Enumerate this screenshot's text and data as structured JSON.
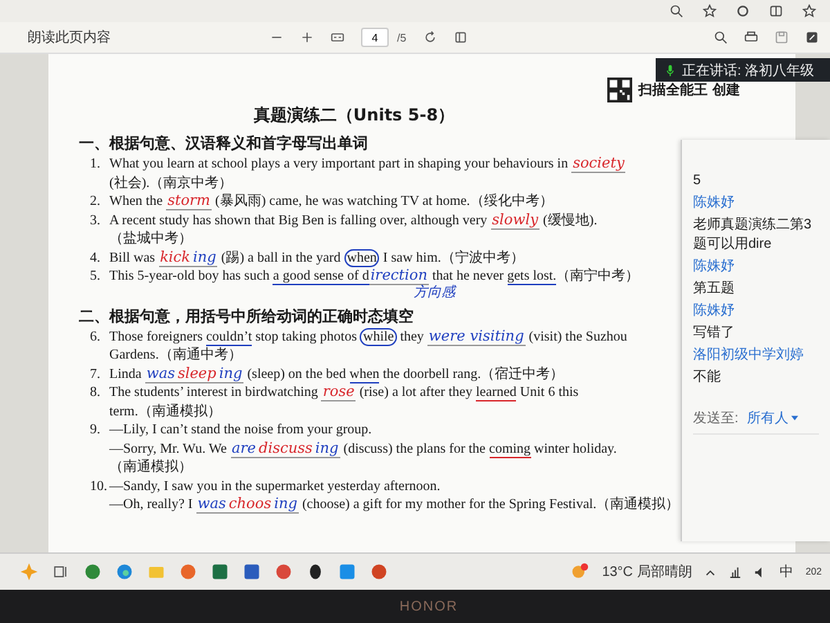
{
  "toolbar": {
    "read_aloud": "朗读此页内容",
    "page_input": "4",
    "page_total": "/5"
  },
  "speaking_banner": "正在讲话: 洛初八年级",
  "document": {
    "scan_header": "扫描全能王 创建",
    "title": "真题演练二（Units 5-8）",
    "sections": [
      {
        "heading": "一、根据句意、汉语释义和首字母写出单词",
        "questions": [
          {
            "number": "1.",
            "lines": [
              {
                "segments": [
                  {
                    "kind": "text",
                    "text": "What you learn at school plays a very important part in shaping your behaviours in "
                  },
                  {
                    "kind": "answer",
                    "text": "society",
                    "color": "#d8262b"
                  }
                ]
              },
              {
                "segments": [
                  {
                    "kind": "text",
                    "text": "(社会).（南京中考）"
                  }
                ]
              }
            ]
          },
          {
            "number": "2.",
            "lines": [
              {
                "segments": [
                  {
                    "kind": "text",
                    "text": "When the "
                  },
                  {
                    "kind": "answer",
                    "text": "storm",
                    "color": "#d8262b"
                  },
                  {
                    "kind": "text",
                    "text": " (暴风雨) came, he was watching TV at home.（绥化中考）"
                  }
                ]
              }
            ]
          },
          {
            "number": "3.",
            "lines": [
              {
                "segments": [
                  {
                    "kind": "text",
                    "text": "A recent study has shown that Big Ben is falling over, although very "
                  },
                  {
                    "kind": "answer",
                    "text": "slowly",
                    "color": "#d8262b"
                  },
                  {
                    "kind": "text",
                    "text": " (缓慢地)."
                  }
                ]
              },
              {
                "segments": [
                  {
                    "kind": "text",
                    "text": "（盐城中考）"
                  }
                ]
              }
            ]
          },
          {
            "number": "4.",
            "lines": [
              {
                "segments": [
                  {
                    "kind": "text",
                    "text": "Bill was "
                  },
                  {
                    "kind": "answer",
                    "text": "kick",
                    "color": "#d8262b"
                  },
                  {
                    "kind": "answer",
                    "text": "ing",
                    "color": "#1f3fbf"
                  },
                  {
                    "kind": "text",
                    "text": " (踢) a ball in the yard "
                  },
                  {
                    "kind": "circled",
                    "text": "when",
                    "color": "#1f3fbf"
                  },
                  {
                    "kind": "text",
                    "text": " I saw him.（宁波中考）"
                  }
                ]
              }
            ]
          },
          {
            "number": "5.",
            "lines": [
              {
                "segments": [
                  {
                    "kind": "text",
                    "text": "This 5-year-old boy has such "
                  },
                  {
                    "kind": "underlined",
                    "text": "a good sense of d",
                    "color": "#1f3fbf"
                  },
                  {
                    "kind": "answer",
                    "text": "irection",
                    "color": "#1f3fbf"
                  },
                  {
                    "kind": "text",
                    "text": " that he never "
                  },
                  {
                    "kind": "underlined",
                    "text": "gets lost.",
                    "color": "#1f3fbf"
                  },
                  {
                    "kind": "text",
                    "text": "（南宁中考）"
                  }
                ]
              }
            ],
            "note": "方向感"
          }
        ]
      },
      {
        "heading": "二、根据句意，用括号中所给动词的正确时态填空",
        "questions": [
          {
            "number": "6.",
            "lines": [
              {
                "segments": [
                  {
                    "kind": "text",
                    "text": "Those foreigners "
                  },
                  {
                    "kind": "underlined",
                    "text": "couldn’t",
                    "color": "#1f3fbf"
                  },
                  {
                    "kind": "text",
                    "text": " stop taking photos "
                  },
                  {
                    "kind": "circled",
                    "text": "while",
                    "color": "#1f3fbf"
                  },
                  {
                    "kind": "text",
                    "text": " they "
                  },
                  {
                    "kind": "answer",
                    "text": "were visiting",
                    "color": "#1f3fbf"
                  },
                  {
                    "kind": "text",
                    "text": " (visit) the Suzhou"
                  }
                ]
              },
              {
                "segments": [
                  {
                    "kind": "text",
                    "text": "Gardens.（南通中考）"
                  }
                ]
              }
            ]
          },
          {
            "number": "7.",
            "lines": [
              {
                "segments": [
                  {
                    "kind": "text",
                    "text": "Linda "
                  },
                  {
                    "kind": "answer",
                    "text": "was",
                    "color": "#1f3fbf"
                  },
                  {
                    "kind": "answer",
                    "text": "sleep",
                    "color": "#d8262b"
                  },
                  {
                    "kind": "answer",
                    "text": "ing",
                    "color": "#1f3fbf"
                  },
                  {
                    "kind": "text",
                    "text": " (sleep) on the bed "
                  },
                  {
                    "kind": "underlined",
                    "text": "when",
                    "color": "#1f3fbf"
                  },
                  {
                    "kind": "text",
                    "text": " the doorbell rang.（宿迁中考）"
                  }
                ]
              }
            ]
          },
          {
            "number": "8.",
            "lines": [
              {
                "segments": [
                  {
                    "kind": "text",
                    "text": "The students’ interest in birdwatching "
                  },
                  {
                    "kind": "answer",
                    "text": "rose",
                    "color": "#d8262b"
                  },
                  {
                    "kind": "text",
                    "text": " (rise) a lot after they "
                  },
                  {
                    "kind": "underlined",
                    "text": "learned",
                    "color": "#d8262b"
                  },
                  {
                    "kind": "text",
                    "text": " Unit 6 this"
                  }
                ]
              },
              {
                "segments": [
                  {
                    "kind": "text",
                    "text": "term.（南通模拟）"
                  }
                ]
              }
            ]
          },
          {
            "number": "9.",
            "lines": [
              {
                "segments": [
                  {
                    "kind": "text",
                    "text": "—Lily, I can’t stand the noise from your group."
                  }
                ]
              },
              {
                "segments": [
                  {
                    "kind": "text",
                    "text": "—Sorry, Mr. Wu. We "
                  },
                  {
                    "kind": "answer",
                    "text": "are",
                    "color": "#1f3fbf"
                  },
                  {
                    "kind": "answer",
                    "text": "discuss",
                    "color": "#d8262b"
                  },
                  {
                    "kind": "answer",
                    "text": "ing",
                    "color": "#1f3fbf"
                  },
                  {
                    "kind": "text",
                    "text": " (discuss) the plans for the "
                  },
                  {
                    "kind": "underlined",
                    "text": "coming",
                    "color": "#d8262b"
                  },
                  {
                    "kind": "text",
                    "text": " winter holiday."
                  }
                ]
              },
              {
                "segments": [
                  {
                    "kind": "text",
                    "text": "（南通模拟）"
                  }
                ]
              }
            ]
          },
          {
            "number": "10.",
            "lines": [
              {
                "segments": [
                  {
                    "kind": "text",
                    "text": "—Sandy, I saw you in the supermarket yesterday afternoon."
                  }
                ]
              },
              {
                "segments": [
                  {
                    "kind": "text",
                    "text": "—Oh, really? I "
                  },
                  {
                    "kind": "answer",
                    "text": "was",
                    "color": "#1f3fbf"
                  },
                  {
                    "kind": "answer",
                    "text": "choos",
                    "color": "#d8262b"
                  },
                  {
                    "kind": "answer",
                    "text": "ing",
                    "color": "#1f3fbf"
                  },
                  {
                    "kind": "text",
                    "text": " (choose) a gift for my mother for the Spring Festival.（南通模拟）"
                  }
                ]
              }
            ]
          }
        ]
      }
    ]
  },
  "chat": {
    "messages": [
      {
        "kind": "message",
        "text": "5"
      },
      {
        "kind": "name",
        "text": "陈姝妤"
      },
      {
        "kind": "message",
        "text": "老师真题演练二第3题可以用dire"
      },
      {
        "kind": "name",
        "text": "陈姝妤"
      },
      {
        "kind": "message",
        "text": "第五题"
      },
      {
        "kind": "name",
        "text": "陈姝妤"
      },
      {
        "kind": "message",
        "text": "写错了"
      },
      {
        "kind": "name",
        "text": "洛阳初级中学刘婷"
      },
      {
        "kind": "message",
        "text": "不能"
      }
    ],
    "send_to_label": "发送至:",
    "send_to_value": "所有人"
  },
  "taskbar": {
    "weather": "13°C 局部晴朗",
    "input_method": "中",
    "clock": "202"
  },
  "bezel": "HONOR"
}
